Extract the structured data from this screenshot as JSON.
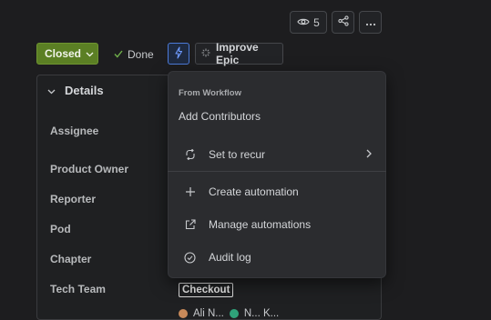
{
  "header": {
    "watch_count": "5"
  },
  "status_row": {
    "status_label": "Closed",
    "done_label": "Done",
    "improve_label": "Improve Epic"
  },
  "details": {
    "title": "Details",
    "fields": [
      "Assignee",
      "Product Owner",
      "Reporter",
      "Pod",
      "Chapter",
      "Tech Team"
    ],
    "tech_team_value": "Checkout",
    "people_partial": [
      "Ali N...",
      "N... K..."
    ]
  },
  "menu": {
    "section_title": "From Workflow",
    "add_contributors": "Add Contributors",
    "items": [
      {
        "label": "Set to recur",
        "icon": "recur-icon"
      },
      {
        "label": "Create automation",
        "icon": "plus-icon"
      },
      {
        "label": "Manage automations",
        "icon": "external-link-icon"
      },
      {
        "label": "Audit log",
        "icon": "check-circle-icon"
      }
    ]
  },
  "colors": {
    "status_green": "#5b7f24",
    "accent_blue": "#4c7bd9",
    "menu_bg": "#2b2c2f",
    "page_bg": "#1d1d1f"
  }
}
